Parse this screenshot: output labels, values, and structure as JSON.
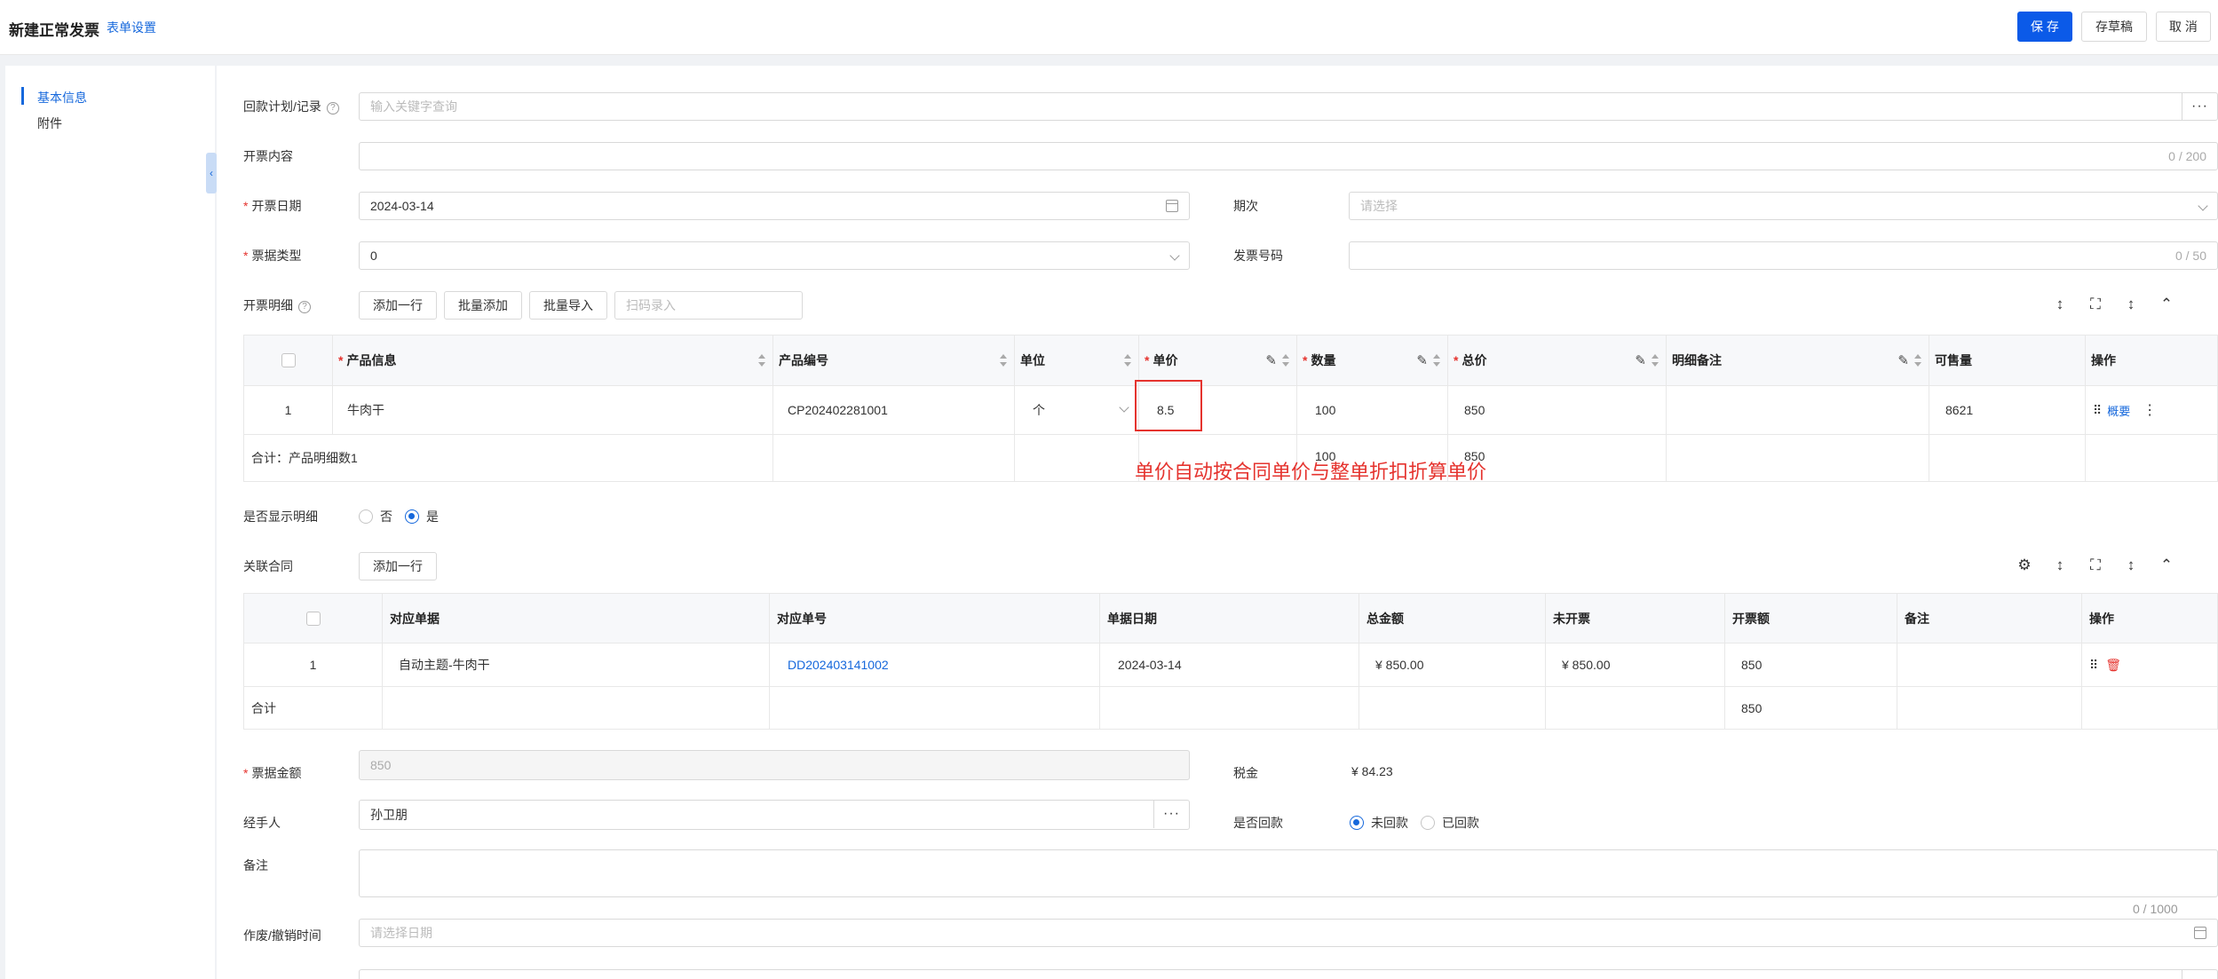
{
  "header": {
    "title": "新建正常发票",
    "form_settings": "表单设置",
    "save": "保 存",
    "draft": "存草稿",
    "cancel": "取 消"
  },
  "sidebar": {
    "items": [
      {
        "label": "基本信息",
        "active": true
      },
      {
        "label": "附件",
        "active": false
      }
    ]
  },
  "form": {
    "payment_plan": {
      "label": "回款计划/记录",
      "placeholder": "输入关键字查询"
    },
    "invoice_content": {
      "label": "开票内容",
      "counter": "0 / 200"
    },
    "invoice_date": {
      "label": "开票日期",
      "value": "2024-03-14"
    },
    "period": {
      "label": "期次",
      "placeholder": "请选择"
    },
    "bill_type": {
      "label": "票据类型",
      "value": "0"
    },
    "invoice_no": {
      "label": "发票号码",
      "counter": "0 / 50"
    },
    "detail": {
      "label": "开票明细",
      "add_row": "添加一行",
      "batch_add": "批量添加",
      "batch_import": "批量导入",
      "scan_placeholder": "扫码录入"
    },
    "show_detail": {
      "label": "是否显示明细",
      "no": "否",
      "yes": "是",
      "selected": "是"
    },
    "related_contract": {
      "label": "关联合同",
      "add_row": "添加一行"
    },
    "bill_amount": {
      "label": "票据金额",
      "value": "850"
    },
    "tax": {
      "label": "税金",
      "value": "¥ 84.23"
    },
    "handler": {
      "label": "经手人",
      "value": "孙卫朋"
    },
    "payback": {
      "label": "是否回款",
      "unpaid": "未回款",
      "paid": "已回款",
      "selected": "未回款"
    },
    "remark": {
      "label": "备注",
      "counter": "0 / 1000"
    },
    "void_time": {
      "label": "作废/撤销时间",
      "placeholder": "请选择日期"
    }
  },
  "detail_table": {
    "headers": [
      "产品信息",
      "产品编号",
      "单位",
      "单价",
      "数量",
      "总价",
      "明细备注",
      "可售量",
      "操作"
    ],
    "rows": [
      {
        "index": "1",
        "product": "牛肉干",
        "code": "CP202402281001",
        "unit": "个",
        "price": "8.5",
        "qty": "100",
        "total": "850",
        "note": "",
        "available": "8621",
        "action": "概要"
      }
    ],
    "summary": {
      "label": "合计：产品明细数1",
      "qty": "100",
      "total": "850"
    }
  },
  "contract_table": {
    "headers": [
      "对应单据",
      "对应单号",
      "单据日期",
      "总金额",
      "未开票",
      "开票额",
      "备注",
      "操作"
    ],
    "rows": [
      {
        "index": "1",
        "doc": "自动主题-牛肉干",
        "doc_no": "DD202403141002",
        "date": "2024-03-14",
        "total": "¥ 850.00",
        "uninvoiced": "¥ 850.00",
        "invoiced": "850",
        "note": ""
      }
    ],
    "summary": {
      "label": "合计",
      "invoiced": "850"
    }
  },
  "annotation": "单价自动按合同单价与整单折扣折算单价",
  "colors": {
    "primary": "#0b5ae8",
    "link": "#1668dc",
    "required": "#e5332e",
    "annotation": "#e5332e"
  }
}
